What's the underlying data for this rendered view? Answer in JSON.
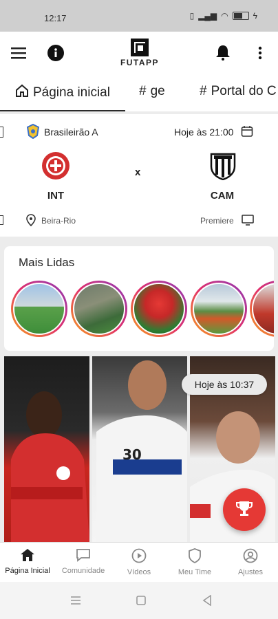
{
  "status": {
    "time": "12:17"
  },
  "app": {
    "logo_text": "FUTAPP"
  },
  "tabs": [
    {
      "label": "Página inicial"
    },
    {
      "label": "ge"
    },
    {
      "label": "Portal do C"
    }
  ],
  "match": {
    "competition": "Brasileirão A",
    "when": "Hoje às 21:00",
    "home": "INT",
    "away": "CAM",
    "versus": "x",
    "venue": "Beira-Rio",
    "broadcast": "Premiere"
  },
  "mais_lidas": {
    "title": "Mais Lidas"
  },
  "news": {
    "time_chip": "Hoje às 10:37"
  },
  "colors": {
    "accent": "#e53935",
    "home_red": "#d32f2f"
  },
  "bottom_nav": [
    {
      "label": "Página Inicial",
      "icon": "home-icon"
    },
    {
      "label": "Comunidade",
      "icon": "chat-icon"
    },
    {
      "label": "Vídeos",
      "icon": "play-icon"
    },
    {
      "label": "Meu Time",
      "icon": "shield-icon"
    },
    {
      "label": "Ajustes",
      "icon": "user-settings-icon"
    }
  ]
}
